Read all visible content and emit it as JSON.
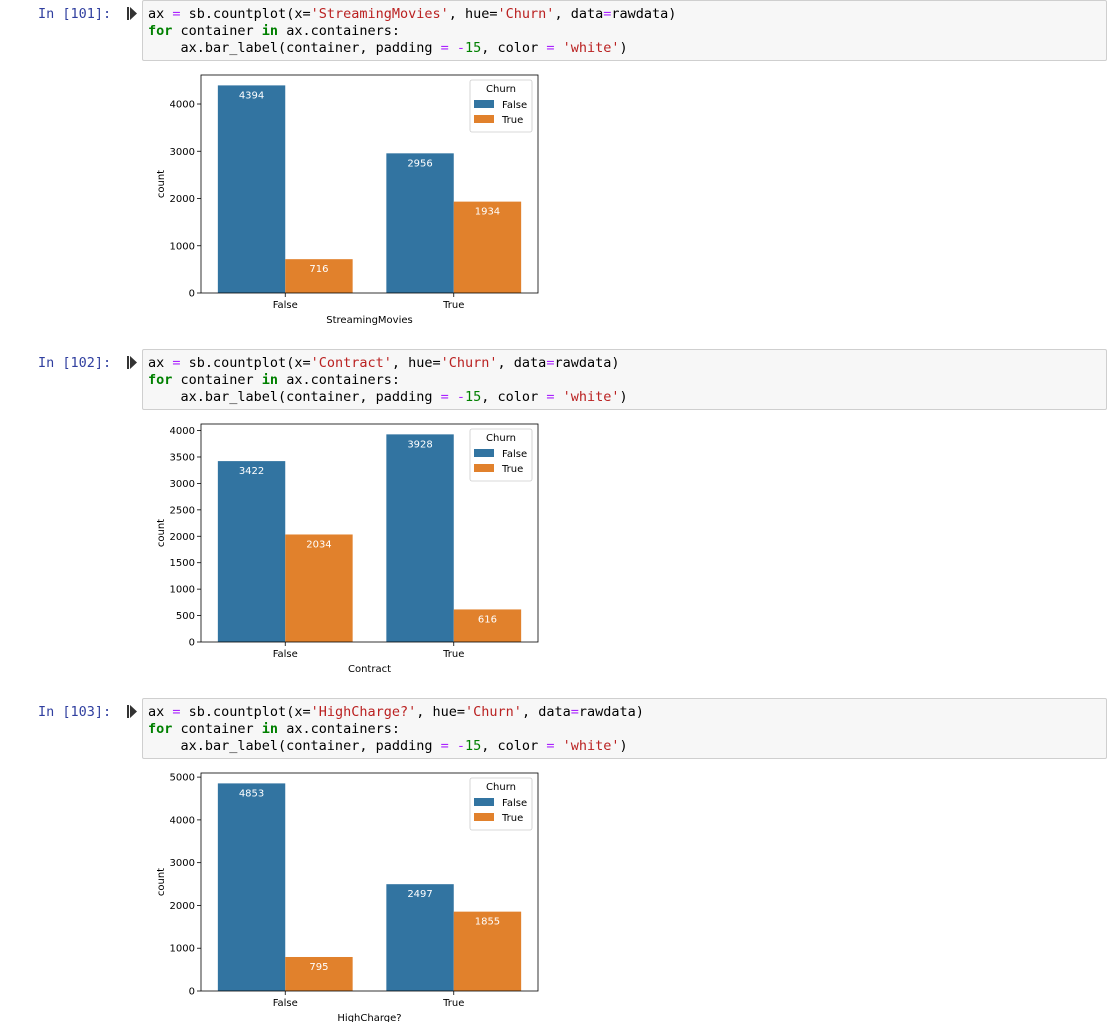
{
  "colors": {
    "false_series": "#3274a1",
    "true_series": "#e1812c",
    "prompt": "#303f9f"
  },
  "cells": [
    {
      "prompt": "In [101]:",
      "code": {
        "var": "ax",
        "eq": " = ",
        "call": "sb.countplot(x=",
        "x_arg": "'StreamingMovies'",
        "hue_pre": ", hue=",
        "hue_arg": "'Churn'",
        "data_pre": ", data",
        "data_eq": "=",
        "data_arg": "rawdata)",
        "line2_for": "for",
        "line2_mid": " container ",
        "line2_in": "in",
        "line2_end": " ax.containers:",
        "line3_pre": "    ax.bar_label(container, padding ",
        "line3_eq": "=",
        "line3_sp": " ",
        "line3_minus": "-",
        "line3_num": "15",
        "line3_mid": ", color ",
        "line3_eq2": "=",
        "line3_sp2": " ",
        "line3_str": "'white'",
        "line3_end": ")"
      }
    },
    {
      "prompt": "In [102]:",
      "code": {
        "var": "ax",
        "eq": " = ",
        "call": "sb.countplot(x=",
        "x_arg": "'Contract'",
        "hue_pre": ", hue=",
        "hue_arg": "'Churn'",
        "data_pre": ", data",
        "data_eq": "=",
        "data_arg": "rawdata)",
        "line2_for": "for",
        "line2_mid": " container ",
        "line2_in": "in",
        "line2_end": " ax.containers:",
        "line3_pre": "    ax.bar_label(container, padding ",
        "line3_eq": "=",
        "line3_sp": " ",
        "line3_minus": "-",
        "line3_num": "15",
        "line3_mid": ", color ",
        "line3_eq2": "=",
        "line3_sp2": " ",
        "line3_str": "'white'",
        "line3_end": ")"
      }
    },
    {
      "prompt": "In [103]:",
      "code": {
        "var": "ax",
        "eq": " = ",
        "call": "sb.countplot(x=",
        "x_arg": "'HighCharge?'",
        "hue_pre": ", hue=",
        "hue_arg": "'Churn'",
        "data_pre": ", data",
        "data_eq": "=",
        "data_arg": "rawdata)",
        "line2_for": "for",
        "line2_mid": " container ",
        "line2_in": "in",
        "line2_end": " ax.containers:",
        "line3_pre": "    ax.bar_label(container, padding ",
        "line3_eq": "=",
        "line3_sp": " ",
        "line3_minus": "-",
        "line3_num": "15",
        "line3_mid": ", color ",
        "line3_eq2": "=",
        "line3_sp2": " ",
        "line3_str": "'white'",
        "line3_end": ")"
      }
    }
  ],
  "chart_data": [
    {
      "type": "bar",
      "categories": [
        "False",
        "True"
      ],
      "series": [
        {
          "name": "False",
          "values": [
            4394,
            2956
          ]
        },
        {
          "name": "True",
          "values": [
            716,
            1934
          ]
        }
      ],
      "xlabel": "StreamingMovies",
      "ylabel": "count",
      "ylim": [
        0,
        4614
      ],
      "yticks": [
        0,
        1000,
        2000,
        3000,
        4000
      ],
      "legend_title": "Churn",
      "legend_position": "upper right",
      "grid": false
    },
    {
      "type": "bar",
      "categories": [
        "False",
        "True"
      ],
      "series": [
        {
          "name": "False",
          "values": [
            3422,
            3928
          ]
        },
        {
          "name": "True",
          "values": [
            2034,
            616
          ]
        }
      ],
      "xlabel": "Contract",
      "ylabel": "count",
      "ylim": [
        0,
        4124
      ],
      "yticks": [
        0,
        500,
        1000,
        1500,
        2000,
        2500,
        3000,
        3500,
        4000
      ],
      "legend_title": "Churn",
      "legend_position": "upper right",
      "grid": false
    },
    {
      "type": "bar",
      "categories": [
        "False",
        "True"
      ],
      "series": [
        {
          "name": "False",
          "values": [
            4853,
            2497
          ]
        },
        {
          "name": "True",
          "values": [
            795,
            1855
          ]
        }
      ],
      "xlabel": "HighCharge?",
      "ylabel": "count",
      "ylim": [
        0,
        5096
      ],
      "yticks": [
        0,
        1000,
        2000,
        3000,
        4000,
        5000
      ],
      "legend_title": "Churn",
      "legend_position": "upper right",
      "grid": false
    }
  ]
}
